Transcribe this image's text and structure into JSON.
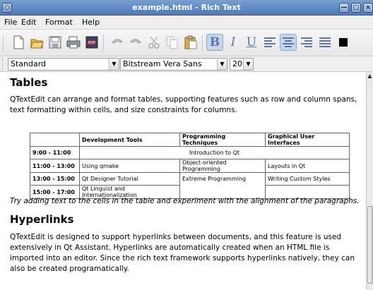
{
  "window": {
    "title": "example.html - Rich Text"
  },
  "menubar": {
    "items": [
      "File",
      "Edit",
      "Format",
      "Help"
    ],
    "mnemonics": [
      "F",
      "E",
      "o",
      "H"
    ]
  },
  "toolbar": {
    "buttons": [
      "new-icon",
      "open-icon",
      "save-icon",
      "print-icon",
      "export-pdf-icon",
      "undo-icon",
      "redo-icon",
      "cut-icon",
      "copy-icon",
      "paste-icon",
      "bold-icon",
      "italic-icon",
      "underline-icon",
      "align-left-icon",
      "align-center-icon",
      "align-right-icon",
      "align-justify-icon",
      "text-color-icon"
    ],
    "bold": "B",
    "italic": "I",
    "underline": "U"
  },
  "formatbar": {
    "style": "Standard",
    "font": "Bitstream Vera Sans",
    "size": "20"
  },
  "document": {
    "h_tables": "Tables",
    "p_tables": "QTextEdit can arrange and format tables, supporting features such as row and column spans, text formatting within cells, and size constraints for columns.",
    "table": {
      "headers": [
        "",
        "Development Tools",
        "Programming Techniques",
        "Graphical User Interfaces"
      ],
      "r1": {
        "time": "9:00 - 11:00",
        "span": "Introduction to Qt"
      },
      "r2": {
        "time": "11:00 - 13:00",
        "c1": "Using qmake",
        "c2": "Object-oriented Programming",
        "c3": "Layouts in Qt"
      },
      "r3": {
        "time": "13:00 - 15:00",
        "c1": "Qt Designer Tutorial",
        "c2": "Extreme Programming",
        "c3": "Writing Custom Styles"
      },
      "r4": {
        "time": "15:00 - 17:00",
        "c1": "Qt Linguist and Internationalization",
        "c3": ""
      }
    },
    "p_try": "Try adding text to the cells in the table and experiment with the alignment of the paragraphs.",
    "h_links": "Hyperlinks",
    "p_links": "QTextEdit is designed to support hyperlinks between documents, and this feature is used extensively in Qt Assistant. Hyperlinks are automatically created when an HTML file is imported into an editor. Since the rich text framework supports hyperlinks natively, they can also be created programatically."
  },
  "colors": {
    "titlebar": "#4f79b8",
    "selection": "#c9d6ea"
  }
}
